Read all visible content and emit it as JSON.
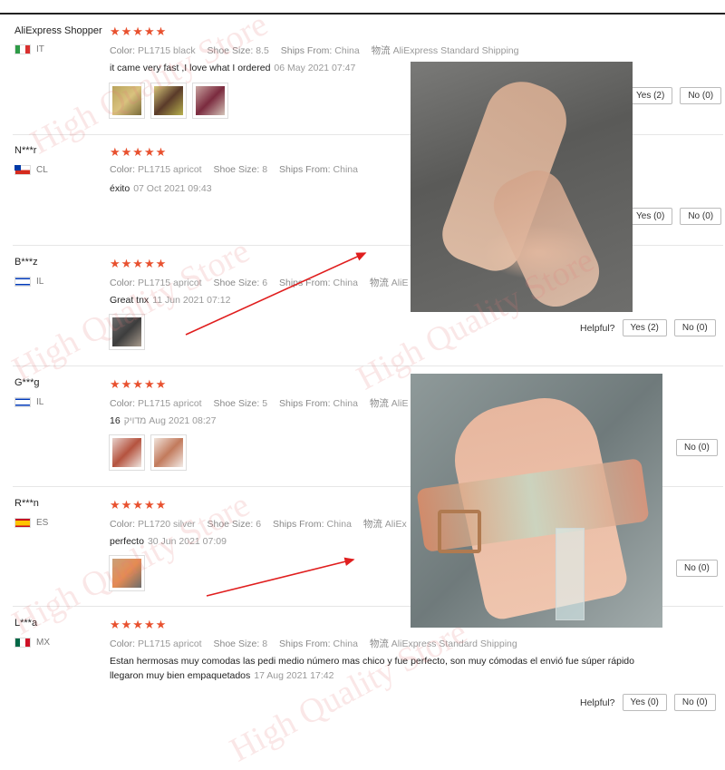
{
  "watermark": "High Quality Store",
  "reviews": [
    {
      "user": "AliExpress Shopper",
      "country": "IT",
      "color": "PL1715 black",
      "size": "8.5",
      "ships": "China",
      "text": "it came very fast ,I love what I ordered",
      "date": "06 May 2021 07:47",
      "shipping_label": "AliExpress Standard Shipping"
    },
    {
      "user": "N***r",
      "country": "CL",
      "color": "PL1715 apricot",
      "size": "8",
      "ships": "China",
      "text": "éxito",
      "date": "07 Oct 2021 09:43"
    },
    {
      "user": "B***z",
      "country": "IL",
      "color": "PL1715 apricot",
      "size": "6",
      "ships": "China",
      "text": "Great tnx",
      "date": "11 Jun 2021 07:12"
    },
    {
      "user": "G***g",
      "country": "IL",
      "color": "PL1715 apricot",
      "size": "5",
      "ships": "China",
      "text": "16",
      "date": "מדויק Aug 2021 08:27"
    },
    {
      "user": "R***n",
      "country": "ES",
      "color": "PL1720 silver",
      "size": "6",
      "ships": "China",
      "text": "perfecto",
      "date": "30 Jun 2021 07:09"
    },
    {
      "user": "L***a",
      "country": "MX",
      "color": "PL1715 apricot",
      "size": "8",
      "ships": "China",
      "text": "Estan hermosas muy comodas las pedi medio número mas chico y fue perfecto, son muy cómodas el envió fue súper rápido llegaron muy bien empaquetados",
      "date": "17 Aug 2021 17:42",
      "shipping_label": "AliExpress Standard Shipping"
    }
  ],
  "labels": {
    "color": "Color:",
    "size": "Shoe Size:",
    "ships": "Ships From:",
    "logistics": "物流",
    "helpful": "Helpful?",
    "yes": "Yes (0)",
    "no": "No (0)",
    "yes2": "Yes (2)",
    "ali_short": "AliE",
    "ali_short2": "AliEx"
  },
  "stars": "★★★★★",
  "colors": {
    "star": "#e8512f"
  }
}
